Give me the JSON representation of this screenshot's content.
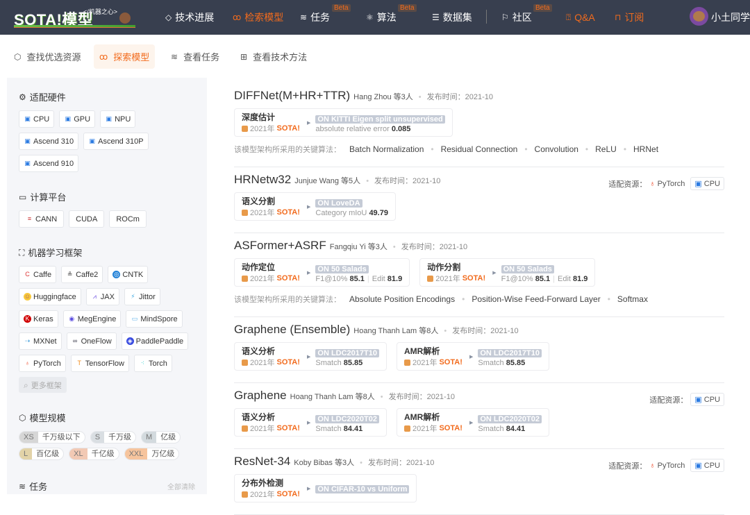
{
  "header": {
    "logo": "SOTA!模型",
    "logo_sub": "</机器之心>",
    "nav": [
      {
        "label": "技术进展",
        "icon": "diamond-icon"
      },
      {
        "label": "检索模型",
        "icon": "models-icon",
        "active": true
      },
      {
        "label": "任务",
        "icon": "layers-icon",
        "beta": "Beta"
      },
      {
        "label": "算法",
        "icon": "atom-icon",
        "beta": "Beta"
      },
      {
        "label": "数据集",
        "icon": "database-icon"
      },
      {
        "label": "社区",
        "icon": "flag-icon",
        "beta": "Beta"
      },
      {
        "label": "Q&A",
        "icon": "question-shield-icon"
      },
      {
        "label": "订阅",
        "icon": "bookmark-icon"
      }
    ],
    "user": "小土同学"
  },
  "subnav": [
    {
      "label": "查找优选资源",
      "icon": "cube-icon"
    },
    {
      "label": "探索模型",
      "icon": "models-icon",
      "active": true
    },
    {
      "label": "查看任务",
      "icon": "layers-icon"
    },
    {
      "label": "查看技术方法",
      "icon": "grid-icon"
    }
  ],
  "sidebar": {
    "hardware": {
      "title": "适配硬件",
      "items": [
        "CPU",
        "GPU",
        "NPU",
        "Ascend 310",
        "Ascend 310P",
        "Ascend 910"
      ]
    },
    "platform": {
      "title": "计算平台",
      "items": [
        "CANN",
        "CUDA",
        "ROCm"
      ]
    },
    "frameworks": {
      "title": "机器学习框架",
      "items": [
        "Caffe",
        "Caffe2",
        "CNTK",
        "Huggingface",
        "JAX",
        "Jittor",
        "Keras",
        "MegEngine",
        "MindSpore",
        "MXNet",
        "OneFlow",
        "PaddlePaddle",
        "PyTorch",
        "TensorFlow",
        "Torch"
      ],
      "more": "更多框架"
    },
    "scale": {
      "title": "模型规模",
      "items": [
        {
          "k": "XS",
          "v": "千万级以下",
          "c": "#d6d6d6"
        },
        {
          "k": "S",
          "v": "千万级",
          "c": "#d9dee2"
        },
        {
          "k": "M",
          "v": "亿级",
          "c": "#d3dade"
        },
        {
          "k": "L",
          "v": "百亿级",
          "c": "#e2d3a8"
        },
        {
          "k": "XL",
          "v": "千亿级",
          "c": "#f2c9b4"
        },
        {
          "k": "XXL",
          "v": "万亿级",
          "c": "#f6c49d"
        }
      ]
    },
    "tasks": {
      "title": "任务",
      "clear": "全部清除"
    }
  },
  "main": {
    "date_label": "发布时间：",
    "algo_label": "该模型架构所采用的关键算法：",
    "res_label": "适配资源：",
    "sota": "SOTA!",
    "colors": {
      "accent": "#f26b1d",
      "header": "#383f4f"
    },
    "models": [
      {
        "name": "DIFFNet(M+HR+TTR)",
        "authors": "Hang Zhou 等3人",
        "date": "2021-10",
        "results": [
          {
            "task": "深度估计",
            "year": "2021年",
            "dataset": "ON KITTI Eigen split unsupervised",
            "metrics": [
              {
                "n": "absolute relative error",
                "v": "0.085"
              }
            ]
          }
        ],
        "algos": [
          "Batch Normalization",
          "Residual Connection",
          "Convolution",
          "ReLU",
          "HRNet"
        ]
      },
      {
        "name": "HRNetw32",
        "authors": "Junjue Wang 等5人",
        "date": "2021-10",
        "resources": [
          "PyTorch",
          "CPU"
        ],
        "results": [
          {
            "task": "语义分割",
            "year": "2021年",
            "dataset": "ON LoveDA",
            "metrics": [
              {
                "n": "Category mIoU",
                "v": "49.79"
              }
            ]
          }
        ]
      },
      {
        "name": "ASFormer+ASRF",
        "authors": "Fangqiu Yi 等3人",
        "date": "2021-10",
        "results": [
          {
            "task": "动作定位",
            "year": "2021年",
            "dataset": "ON 50 Salads",
            "metrics": [
              {
                "n": "F1@10%",
                "v": "85.1"
              },
              {
                "n": "Edit",
                "v": "81.9"
              }
            ]
          },
          {
            "task": "动作分割",
            "year": "2021年",
            "dataset": "ON 50 Salads",
            "metrics": [
              {
                "n": "F1@10%",
                "v": "85.1"
              },
              {
                "n": "Edit",
                "v": "81.9"
              }
            ]
          }
        ],
        "algos": [
          "Absolute Position Encodings",
          "Position-Wise Feed-Forward Layer",
          "Softmax"
        ]
      },
      {
        "name": "Graphene (Ensemble)",
        "authors": "Hoang Thanh Lam 等8人",
        "date": "2021-10",
        "results": [
          {
            "task": "语义分析",
            "year": "2021年",
            "dataset": "ON LDC2017T10",
            "metrics": [
              {
                "n": "Smatch",
                "v": "85.85"
              }
            ]
          },
          {
            "task": "AMR解析",
            "year": "2021年",
            "dataset": "ON LDC2017T10",
            "metrics": [
              {
                "n": "Smatch",
                "v": "85.85"
              }
            ]
          }
        ]
      },
      {
        "name": "Graphene",
        "authors": "Hoang Thanh Lam 等8人",
        "date": "2021-10",
        "resources": [
          "CPU"
        ],
        "results": [
          {
            "task": "语义分析",
            "year": "2021年",
            "dataset": "ON LDC2020T02",
            "metrics": [
              {
                "n": "Smatch",
                "v": "84.41"
              }
            ]
          },
          {
            "task": "AMR解析",
            "year": "2021年",
            "dataset": "ON LDC2020T02",
            "metrics": [
              {
                "n": "Smatch",
                "v": "84.41"
              }
            ]
          }
        ]
      },
      {
        "name": "ResNet-34",
        "authors": "Koby Bibas 等3人",
        "date": "2021-10",
        "resources": [
          "PyTorch",
          "CPU"
        ],
        "results": [
          {
            "task": "分布外检测",
            "year": "2021年",
            "dataset": "ON CIFAR-10 vs Uniform",
            "metrics": []
          }
        ]
      }
    ]
  }
}
